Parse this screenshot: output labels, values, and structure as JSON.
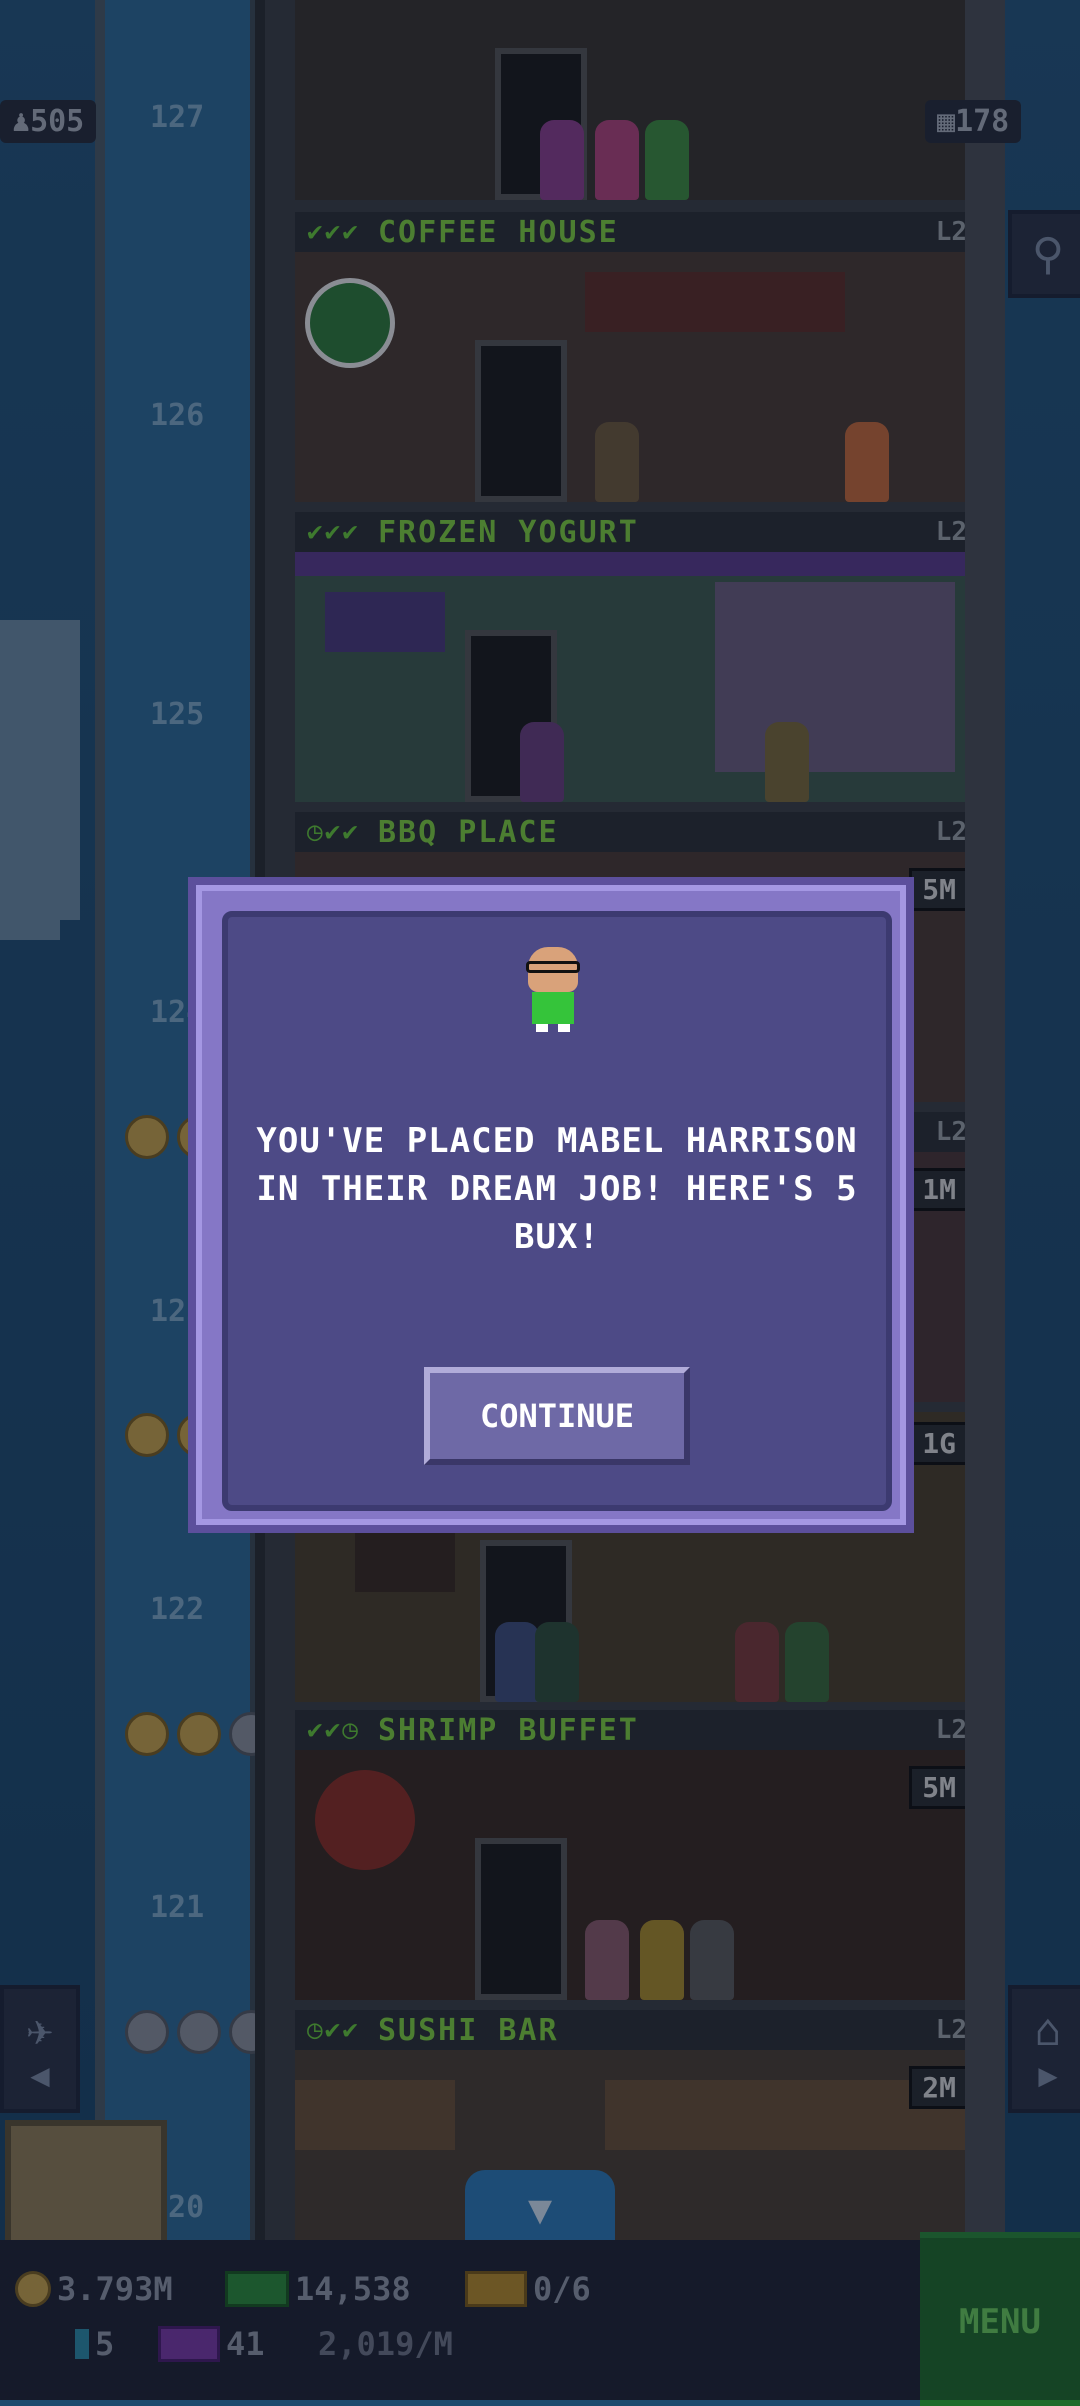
{
  "hud": {
    "population": "505",
    "floors": "178"
  },
  "floor_numbers": [
    "127",
    "126",
    "125",
    "124",
    "123",
    "122",
    "121",
    "120"
  ],
  "floors": [
    {
      "name": "COFFEE HOUSE",
      "checks": "✔✔✔",
      "level": "L2",
      "money": ""
    },
    {
      "name": "FROZEN YOGURT",
      "checks": "✔✔✔",
      "level": "L2",
      "money": ""
    },
    {
      "name": "BBQ PLACE",
      "checks": "◷✔✔",
      "level": "L2",
      "money": "5M"
    },
    {
      "name": "",
      "checks": "",
      "level": "L2",
      "money": "1M"
    },
    {
      "name": "",
      "checks": "",
      "level": "",
      "money": "1G"
    },
    {
      "name": "SHRIMP BUFFET",
      "checks": "✔✔◷",
      "level": "L2",
      "money": "5M"
    },
    {
      "name": "SUSHI BAR",
      "checks": "◷✔✔",
      "level": "L2",
      "money": "2M"
    }
  ],
  "dialog": {
    "message": "YOU'VE PLACED MABEL HARRISON IN THEIR DREAM JOB! HERE'S 5 BUX!",
    "button": "CONTINUE"
  },
  "bottom": {
    "coins": "3.793M",
    "bux_cash": "14,538",
    "tickets": "0/6",
    "items": "5",
    "vip": "41",
    "income": "2,019/M",
    "menu": "MENU"
  },
  "colors": {
    "dialog_bg": "#4d4a86",
    "dialog_border": "#8577c6",
    "floor_name": "#7fcf3f",
    "menu_bg": "#1f6b2a"
  }
}
